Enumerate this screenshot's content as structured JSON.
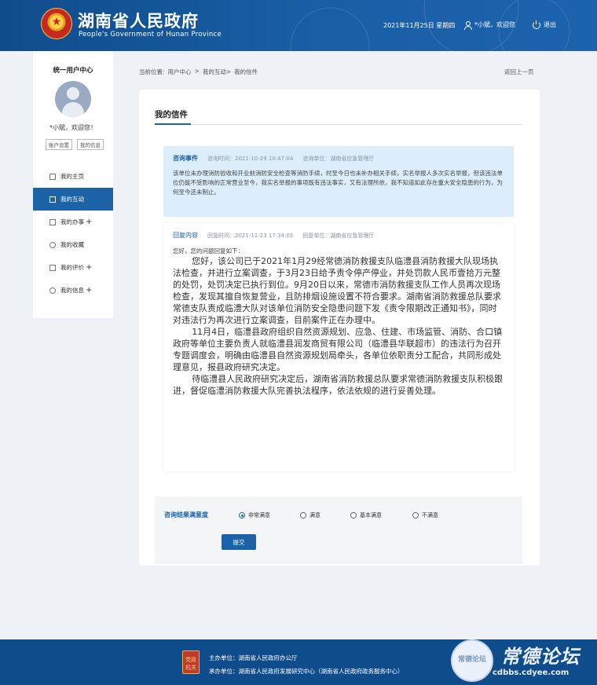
{
  "header": {
    "title": "湖南省人民政府",
    "subtitle": "People's Government of Hunan Province",
    "date": "2021年11月25日 星期四",
    "user": "*小斌，欢迎您",
    "logout": "退出"
  },
  "sidebar": {
    "title": "统一用户中心",
    "welcome": "*小斌，欢迎您！",
    "account_settings": "账户设置",
    "my_info": "我的信息",
    "items": [
      {
        "label": "我的主页",
        "plus": ""
      },
      {
        "label": "我的互动",
        "plus": ""
      },
      {
        "label": "我的办事",
        "plus": "+"
      },
      {
        "label": "我的收藏",
        "plus": ""
      },
      {
        "label": "我的评价",
        "plus": "+"
      },
      {
        "label": "我的信息",
        "plus": "+"
      }
    ]
  },
  "breadcrumb": {
    "prefix": "当前位置:",
    "items": [
      "用户中心",
      ">",
      "我的互动>",
      "我的信件"
    ],
    "back": "返回上一页"
  },
  "letter": {
    "title": "我的信件",
    "query": {
      "label": "咨询事件",
      "time": "咨询时间：2021-10-29 10:47:04",
      "unit": "咨询单位：湖南省应急管理厅",
      "text": "该单位未办理消防验收和开业前消防安全检查等消防手续，时至今日也未补办相关手续，实名举报人多次实名举报，但该违法单位仍能不受影响的正常营业至今，我实名举报的事项既有违法事实，又有法理所依，我不知道如此存在重大安全隐患的行为，为何至今还未制止。"
    },
    "reply": {
      "label": "回复内容",
      "time": "回复时间：2021-11-23 17:34:05",
      "unit": "回复单位：湖南省应急管理厅",
      "greeting": "您好，您的问题回复如下：",
      "paragraphs": [
        "您好，该公司已于2021年1月29经常德消防救援支队临澧县消防救援大队现场执法检查，并进行立案调查，于3月23日给予责令停产停业，并处罚款人民币壹拾万元整的处罚，处罚决定已执行到位。9月20日以来，常德市消防救援支队工作人员再次现场检查，发现其擅自恢复营业，且防排烟设施设置不符合要求。湖南省消防救援总队要求常德支队责成临澧大队对该单位消防安全隐患问题下发《责令限期改正通知书》，同时对违法行为再次进行立案调查，目前案件正在办理中。",
        "11月4日，临澧县政府组织自然资源规划、应急、住建、市场监管、消防、合口镇政府等单位主要负责人就临澧县润发商贸有限公司（临澧县华联超市）的违法行为召开专题调度会，明确由临澧县自然资源规划局牵头，各单位依职责分工配合，共同形成处理意见，报县政府研究决定。",
        "待临澧县人民政府研究决定后，湖南省消防救援总队要求常德消防救援支队积极跟进，督促临澧消防救援大队完善执法程序，依法依规的进行妥善处理。"
      ]
    },
    "rating": {
      "label": "咨询结果满意度",
      "options": [
        "非常满意",
        "满意",
        "基本满意",
        "不满意"
      ],
      "selected": "非常满意",
      "submit": "提交"
    }
  },
  "footer": {
    "line1": "主办单位：湖南省人民政府办公厅",
    "line2": "承办单位：湖南省人民政府发展研究中心（湖南省人民政府政务服务中心）",
    "badge": "党政机关"
  },
  "watermark": {
    "text": "常德论坛",
    "url": "cdbbs.cdyee.com",
    "badge": "常德论坛"
  },
  "colors": {
    "header_bg": "#0f4c8c",
    "accent": "#1b62a7",
    "query_bg": "#dceefb",
    "page_bg": "#eef2f6"
  }
}
